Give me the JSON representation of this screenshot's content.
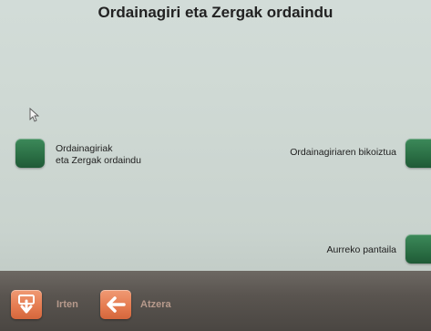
{
  "header": {
    "title": "Ordainagiri eta Zergak ordaindu"
  },
  "options": {
    "left": {
      "line1": "Ordainagiriak",
      "line2": "eta Zergak ordaindu"
    },
    "right1": {
      "label": "Ordainagiriaren bikoiztua"
    },
    "right2": {
      "label": "Aurreko pantaila"
    }
  },
  "bottombar": {
    "irten": {
      "label": "Irten",
      "icon": "exit-arrow-down-icon"
    },
    "atzera": {
      "label": "Atzera",
      "icon": "arrow-left-icon"
    }
  },
  "colors": {
    "option_button": "#2a6e44",
    "nav_button": "#e47a4f",
    "background": "#cfd9d4"
  }
}
